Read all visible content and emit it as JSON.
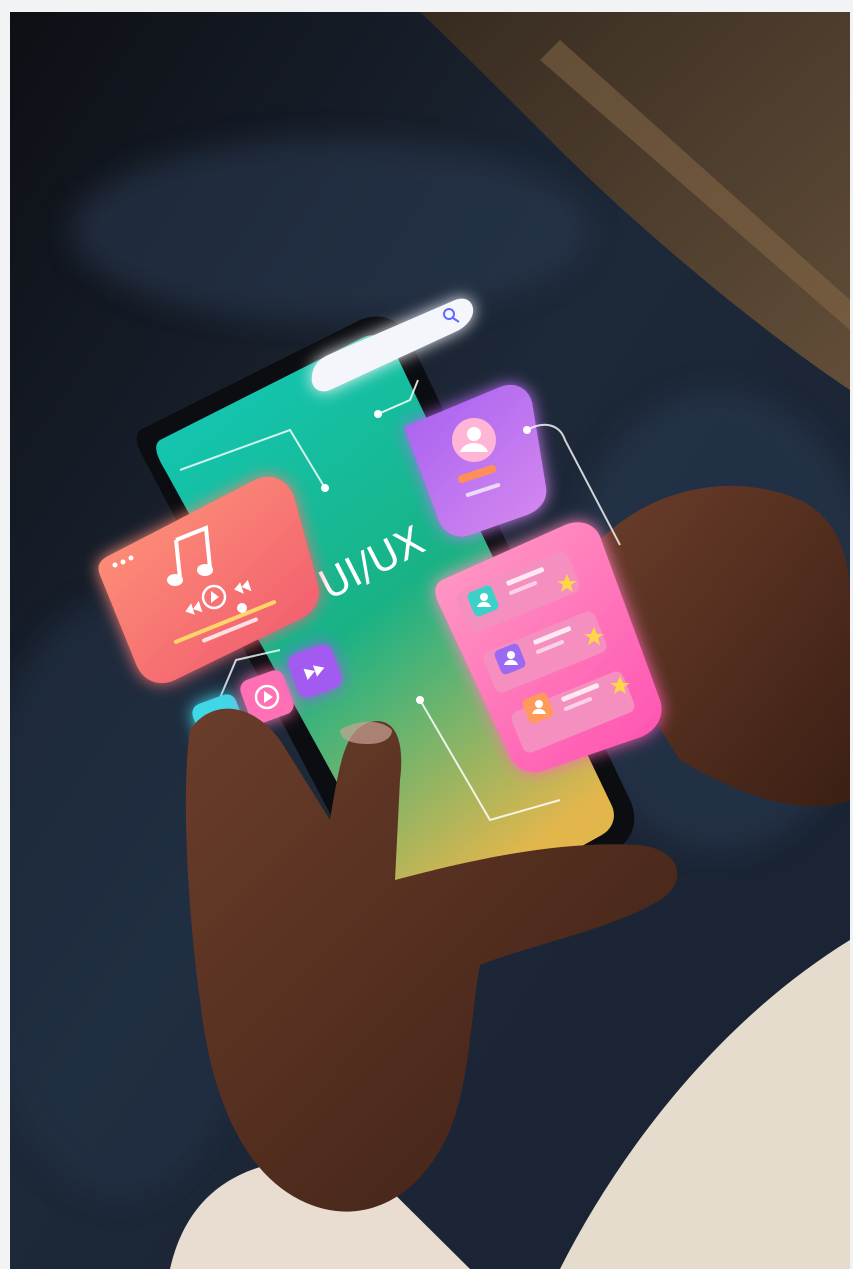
{
  "photo": {
    "screen_text": "UI/UX",
    "search_icon": "search-icon",
    "music_icon": "music-note-icon",
    "controls": [
      "rewind-icon",
      "play-icon",
      "fast-forward-icon"
    ],
    "profile_icon": "user-profile-icon",
    "list_item_icons": [
      "user-icon",
      "star-icon"
    ],
    "colors": {
      "screen_top": "#12c9b8",
      "screen_mid": "#18b58a",
      "screen_bottom": "#e0b54a",
      "music_card": "#ff7a6a",
      "profile_card": "#b36be0",
      "list_card": "#ff73b8",
      "search_bar": "#f4f6fb",
      "background": "#1b2433"
    }
  }
}
